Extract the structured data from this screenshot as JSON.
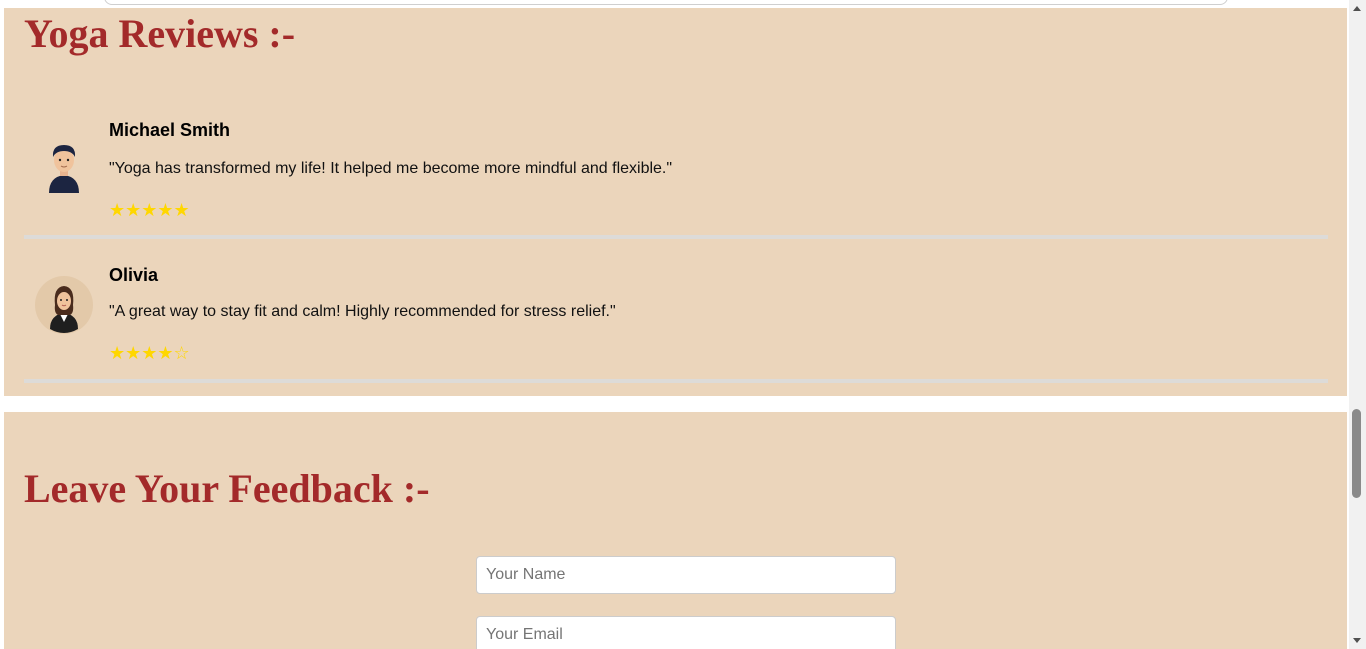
{
  "reviews": {
    "title": "Yoga Reviews :-",
    "items": [
      {
        "name": "Michael Smith",
        "text": "\"Yoga has transformed my life! It helped me become more mindful and flexible.\"",
        "rating": 5,
        "stars": "★★★★★"
      },
      {
        "name": "Olivia",
        "text": "\"A great way to stay fit and calm! Highly recommended for stress relief.\"",
        "rating": 4,
        "stars": "★★★★☆"
      }
    ]
  },
  "feedback": {
    "title": "Leave Your Feedback :-",
    "name_placeholder": "Your Name",
    "email_placeholder": "Your Email"
  },
  "colors": {
    "section_bg": "#ebd5bb",
    "heading": "#a32a2a",
    "star": "#ffd700"
  },
  "icons": {
    "avatar_1": "man-avatar-icon",
    "avatar_2": "woman-avatar-icon"
  }
}
